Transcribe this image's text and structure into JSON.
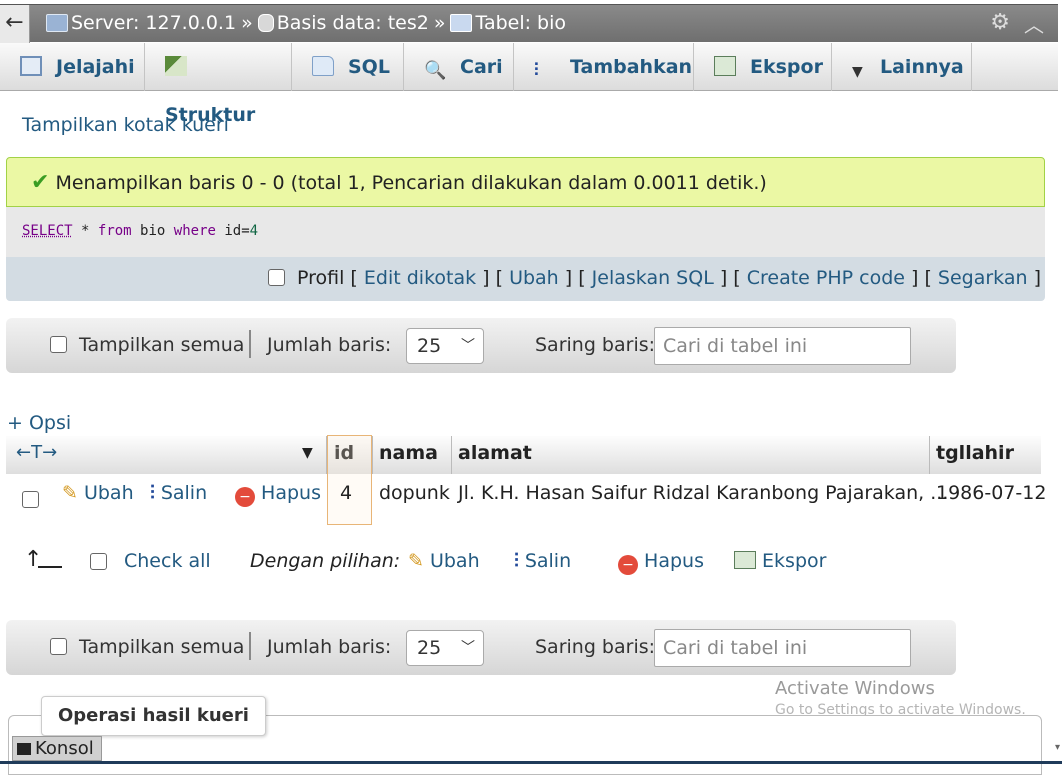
{
  "breadcrumb": {
    "back": "←",
    "server": "Server: 127.0.0.1",
    "database": "Basis data: tes2",
    "table": "Tabel: bio",
    "separator": "»"
  },
  "tabs": [
    {
      "label": "Jelajahi",
      "icon": "browse-icon"
    },
    {
      "label": "Struktur",
      "icon": "structure-icon"
    },
    {
      "label": "SQL",
      "icon": "sql-icon"
    },
    {
      "label": "Cari",
      "icon": "search-icon"
    },
    {
      "label": "Tambahkan",
      "icon": "insert-icon"
    },
    {
      "label": "Ekspor",
      "icon": "export-icon"
    },
    {
      "label": "Lainnya",
      "icon": "chevron-down-icon"
    }
  ],
  "show_query_box": "Tampilkan kotak kueri",
  "success_message": "Menampilkan baris 0 - 0 (total 1, Pencarian dilakukan dalam 0.0011 detik.)",
  "sql": {
    "select": "SELECT",
    "star": "*",
    "from": "from",
    "table": "bio",
    "where": "where",
    "condition": "id=",
    "value": "4"
  },
  "sql_links": {
    "profile": "Profil",
    "edit_inline": "Edit dikotak",
    "edit": "Ubah",
    "explain": "Jelaskan SQL",
    "php_code": "Create PHP code",
    "refresh": "Segarkan"
  },
  "navbar": {
    "show_all": "Tampilkan semua",
    "rows_label": "Jumlah baris:",
    "rows_value": "25",
    "filter_label": "Saring baris:",
    "filter_placeholder": "Cari di tabel ini"
  },
  "options_link": "+ Opsi",
  "table": {
    "arrows": "←T→",
    "columns": [
      "id",
      "nama",
      "alamat",
      "tgllahir"
    ],
    "rows": [
      {
        "id": "4",
        "nama": "dopunk",
        "alamat": "Jl. K.H. Hasan Saifur Ridzal Karanbong Pajarakan, ...",
        "tgllahir": "1986-07-12"
      }
    ],
    "row_actions": {
      "edit": "Ubah",
      "copy": "Salin",
      "delete": "Hapus"
    }
  },
  "bulk": {
    "check_all": "Check all",
    "with_selected": "Dengan pilihan:",
    "edit": "Ubah",
    "copy": "Salin",
    "delete": "Hapus",
    "export": "Ekspor"
  },
  "watermark": {
    "line1": "Activate Windows",
    "line2": "Go to Settings to activate Windows."
  },
  "query_ops_label": "Operasi hasil kueri",
  "console_label": "Konsol",
  "colors": {
    "link": "#235a81",
    "success_bg": "#ebf8a4",
    "sql_links_bg": "#d3dce3",
    "delete_icon": "#e34b3b"
  }
}
